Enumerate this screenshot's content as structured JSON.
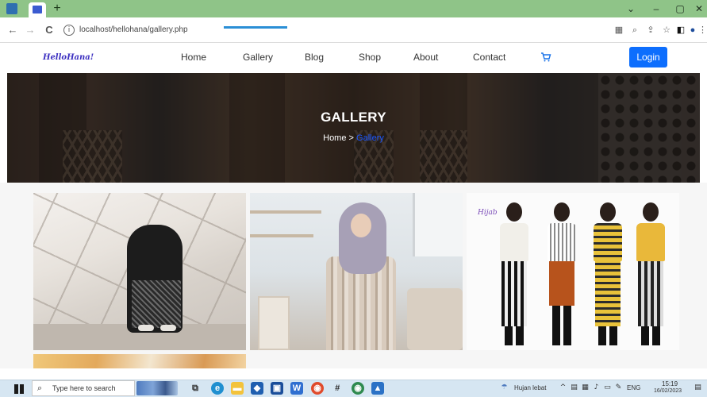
{
  "browser": {
    "new_tab_label": "+",
    "window_controls": {
      "dropdown": "⌄",
      "minimize": "–",
      "maximize": "▢",
      "close": "✕"
    },
    "nav": {
      "back": "←",
      "forward": "→",
      "reload": "C"
    },
    "url": "localhost/hellohana/gallery.php",
    "toolbar_icons": [
      "page-icon",
      "zoom-icon",
      "share-icon",
      "star-icon",
      "sidebar-icon",
      "profile-icon",
      "menu-icon"
    ]
  },
  "site": {
    "logo": "HelloHana!",
    "nav": [
      {
        "label": "Home"
      },
      {
        "label": "Gallery",
        "active": true
      },
      {
        "label": "Blog"
      },
      {
        "label": "Shop"
      },
      {
        "label": "About"
      },
      {
        "label": "Contact"
      }
    ],
    "cart_icon": "cart-icon",
    "login_label": "Login",
    "accent_color": "#0d6efd"
  },
  "hero": {
    "title": "GALLERY",
    "breadcrumb": {
      "home": "Home",
      "separator": ">",
      "current": "Gallery"
    }
  },
  "gallery": {
    "photo3_tag": "Hijab"
  },
  "taskbar": {
    "search_placeholder": "Type here to search",
    "weather": "Hujan lebat",
    "language": "ENG",
    "time": "15:19",
    "date": "16/02/2023"
  }
}
